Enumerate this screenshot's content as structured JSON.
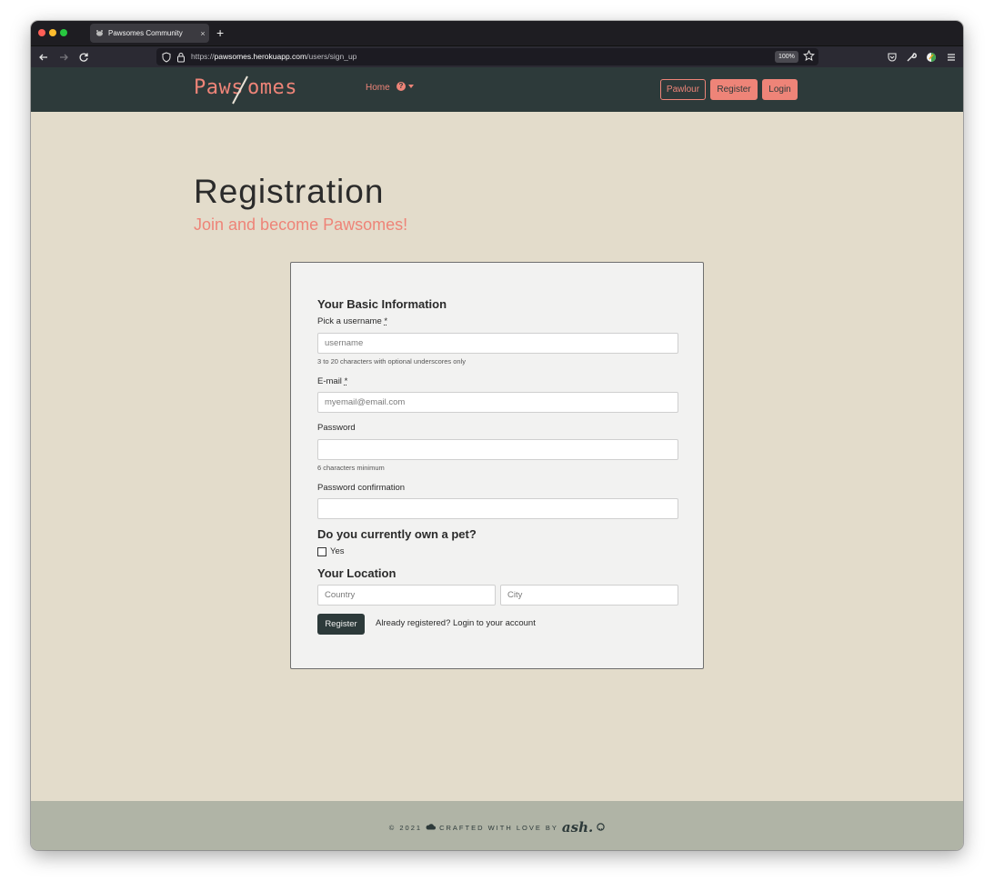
{
  "browser": {
    "tab_title": "Pawsomes Community",
    "new_tab": "+",
    "url_scheme": "https://",
    "url_host": "pawsomes.herokuapp.com",
    "url_path": "/users/sign_up",
    "zoom": "100%"
  },
  "header": {
    "brand_left": "Paws",
    "brand_right": "omes",
    "nav_home": "Home",
    "help_glyph": "?",
    "buttons": {
      "pawlour": "Pawlour",
      "register": "Register",
      "login": "Login"
    },
    "colors": {
      "background": "#2d3a3a",
      "accent": "#ee8478"
    }
  },
  "page": {
    "title": "Registration",
    "subtitle": "Join and become Pawsomes!"
  },
  "form": {
    "basic_heading": "Your Basic Information",
    "username": {
      "label": "Pick a username",
      "required_mark": "*",
      "placeholder": "username",
      "hint": "3 to 20 characters with optional underscores only"
    },
    "email": {
      "label": "E-mail",
      "required_mark": "*",
      "placeholder": "myemail@email.com"
    },
    "password": {
      "label": "Password",
      "hint": "6 characters minimum"
    },
    "password_confirmation": {
      "label": "Password confirmation"
    },
    "pet_heading": "Do you currently own a pet?",
    "pet_option": "Yes",
    "location_heading": "Your Location",
    "country_placeholder": "Country",
    "city_placeholder": "City",
    "submit": "Register",
    "login_link": "Already registered? Login to your account"
  },
  "footer": {
    "year_text": "© 2021",
    "crafted_text": "CRAFTED WITH LOVE BY",
    "signature": "ash."
  }
}
